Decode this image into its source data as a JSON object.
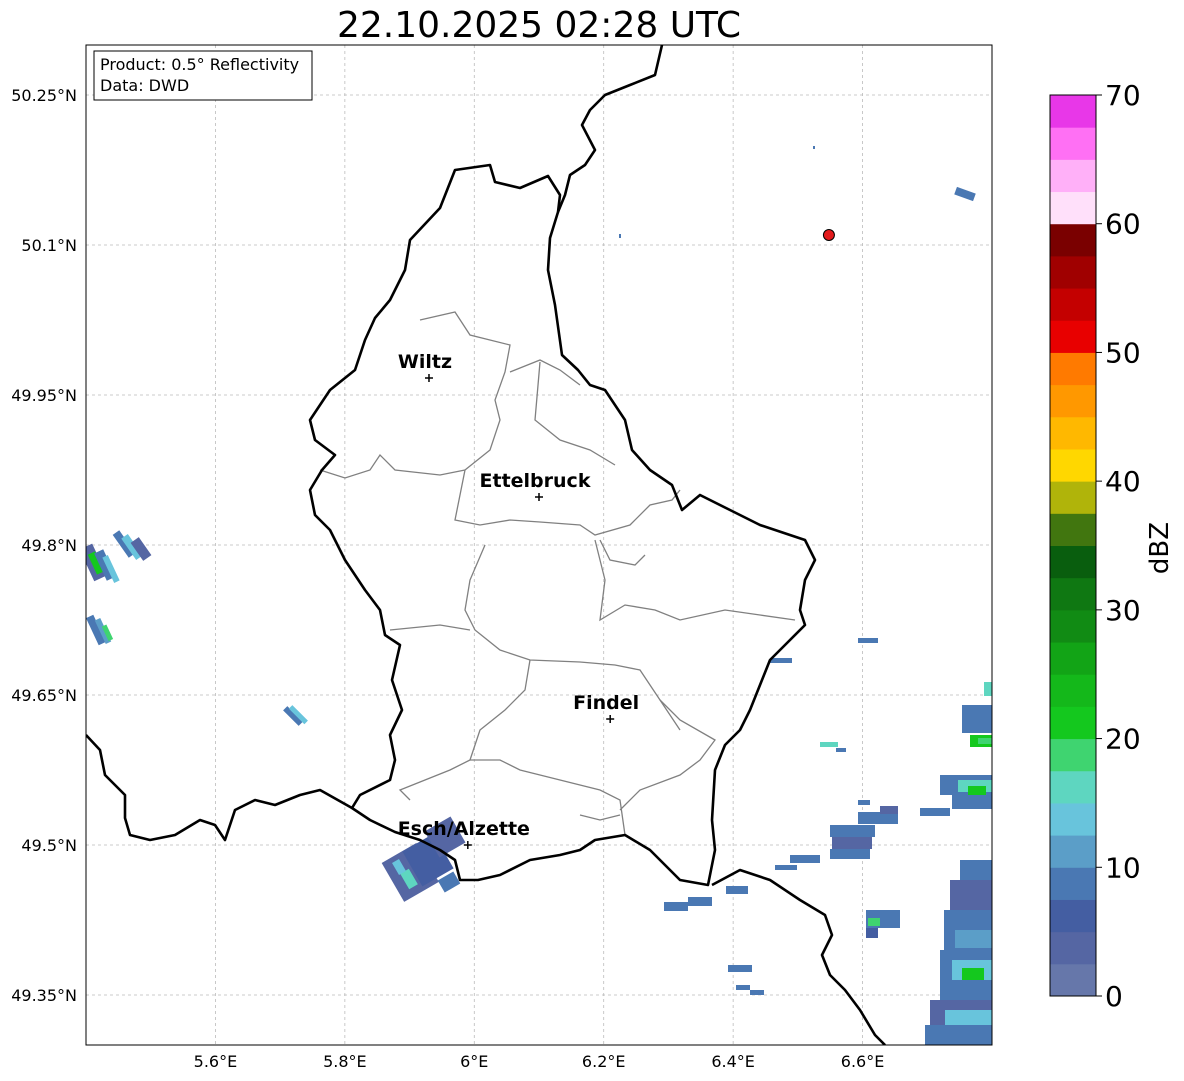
{
  "title": "22.10.2025 02:28 UTC",
  "info_box": {
    "line1": "Product: 0.5° Reflectivity",
    "line2": "Data: DWD"
  },
  "map": {
    "lat_ticks": [
      "50.25°N",
      "50.1°N",
      "49.95°N",
      "49.8°N",
      "49.65°N",
      "49.5°N",
      "49.35°N"
    ],
    "lon_ticks": [
      "5.6°E",
      "5.8°E",
      "6°E",
      "6.2°E",
      "6.4°E",
      "6.6°E"
    ],
    "lat_values": [
      50.25,
      50.1,
      49.95,
      49.8,
      49.65,
      49.5,
      49.35
    ],
    "lon_values": [
      5.6,
      5.8,
      6.0,
      6.2,
      6.4,
      6.6
    ],
    "extent": {
      "lon_min": 5.4,
      "lon_max": 6.8,
      "lat_min": 49.3,
      "lat_max": 50.3
    },
    "cities": [
      {
        "name": "Wiltz",
        "lon": 5.93,
        "lat": 49.967
      },
      {
        "name": "Ettelbruck",
        "lon": 6.1,
        "lat": 49.848
      },
      {
        "name": "Findel",
        "lon": 6.21,
        "lat": 49.626
      },
      {
        "name": "Esch/Alzette",
        "lon": 5.99,
        "lat": 49.5
      }
    ],
    "radar_site": {
      "lon": 6.548,
      "lat": 50.11,
      "color": "#e31a1c"
    },
    "grid": true
  },
  "colorbar": {
    "label": "dBZ",
    "ticks": [
      "0",
      "10",
      "20",
      "30",
      "40",
      "50",
      "60",
      "70"
    ],
    "min": 0,
    "max": 70,
    "colors": [
      "#6677aa",
      "#5566a3",
      "#445ea2",
      "#4a78b3",
      "#5b9ec8",
      "#68c4dc",
      "#5ed6c0",
      "#3fd470",
      "#14c81e",
      "#14b81a",
      "#12a416",
      "#118b14",
      "#0f7812",
      "#095e0e",
      "#41760f",
      "#b0b40a",
      "#ffd700",
      "#ffb800",
      "#ff9800",
      "#ff7a00",
      "#e80000",
      "#c40000",
      "#a00000",
      "#7a0000",
      "#ffe0fa",
      "#ffb0f8",
      "#ff70f4",
      "#e837e8"
    ]
  }
}
